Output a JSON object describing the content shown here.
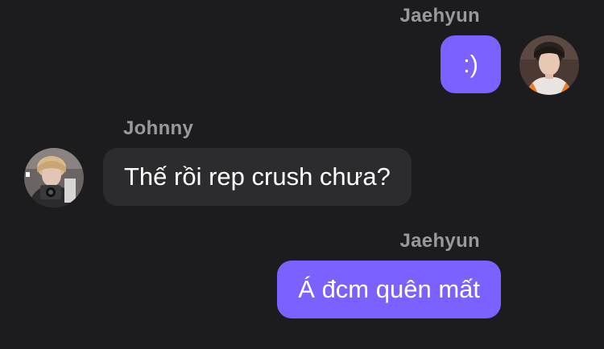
{
  "messages": [
    {
      "sender": "Jaehyun",
      "text": ":)",
      "direction": "outgoing",
      "avatar_icon": "jaehyun-avatar"
    },
    {
      "sender": "Johnny",
      "text": "Thế rồi rep crush chưa?",
      "direction": "incoming",
      "avatar_icon": "johnny-avatar"
    },
    {
      "sender": "Jaehyun",
      "text": "Á đcm quên mất",
      "direction": "outgoing"
    }
  ],
  "colors": {
    "background": "#1c1c1e",
    "outgoing_bubble": "#7b61ff",
    "incoming_bubble": "#2c2c2e",
    "sender_name": "#98989f",
    "message_text": "#ffffff"
  }
}
